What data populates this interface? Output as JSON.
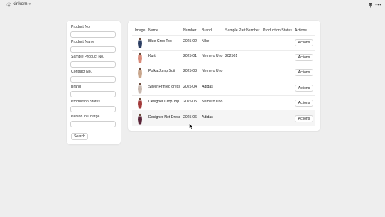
{
  "app": {
    "title": "kirikom",
    "title_chevron": "▾",
    "icons": [
      "app-logo-icon",
      "pin-icon",
      "more-icon"
    ]
  },
  "filters": {
    "fields": [
      {
        "label": "Product No.",
        "value": "",
        "placeholder": ""
      },
      {
        "label": "Product Name",
        "value": "",
        "placeholder": ""
      },
      {
        "label": "Sample Product No.",
        "value": "",
        "placeholder": ""
      },
      {
        "label": "Contract No.",
        "value": "",
        "placeholder": ""
      },
      {
        "label": "Brand",
        "value": "",
        "placeholder": ""
      },
      {
        "label": "Production Status",
        "value": "",
        "placeholder": ""
      },
      {
        "label": "Person in Charge",
        "value": "",
        "placeholder": ""
      }
    ],
    "search_label": "Search"
  },
  "table": {
    "headers": {
      "image": "Image",
      "name": "Name",
      "number": "Number",
      "brand": "Brand",
      "sample_part_number": "Sample Part Number",
      "production_status": "Production Status",
      "actions": "Actions"
    },
    "rows": [
      {
        "name": "Blue Crop Top",
        "number": "2025-02",
        "brand": "Nike",
        "sample_part_number": "",
        "production_status": "",
        "action": "Actions",
        "thumb_color": "#2b3e63"
      },
      {
        "name": "Kurti",
        "number": "2025-01",
        "brand": "Nemero Uno",
        "sample_part_number": "202501",
        "production_status": "",
        "action": "Actions",
        "thumb_color": "#d98b7a"
      },
      {
        "name": "Polka Jump Suit",
        "number": "2025-03",
        "brand": "Nemero Uno",
        "sample_part_number": "",
        "production_status": "",
        "action": "Actions",
        "thumb_color": "#c9a68c"
      },
      {
        "name": "Silver Printed dress",
        "number": "2025-04",
        "brand": "Adidas",
        "sample_part_number": "",
        "production_status": "",
        "action": "Actions",
        "thumb_color": "#c9b9b0"
      },
      {
        "name": "Designer Crop Top",
        "number": "2025-05",
        "brand": "Nemero Uno",
        "sample_part_number": "",
        "production_status": "",
        "action": "Actions",
        "thumb_color": "#a33a3a"
      },
      {
        "name": "Designer Net Dress",
        "number": "2025-06",
        "brand": "Adidas",
        "sample_part_number": "",
        "production_status": "",
        "action": "Actions",
        "thumb_color": "#5a2438"
      }
    ]
  },
  "colors": {
    "background": "#eeeeee",
    "panel": "#ffffff",
    "hover_row": "#f5f5f5"
  }
}
